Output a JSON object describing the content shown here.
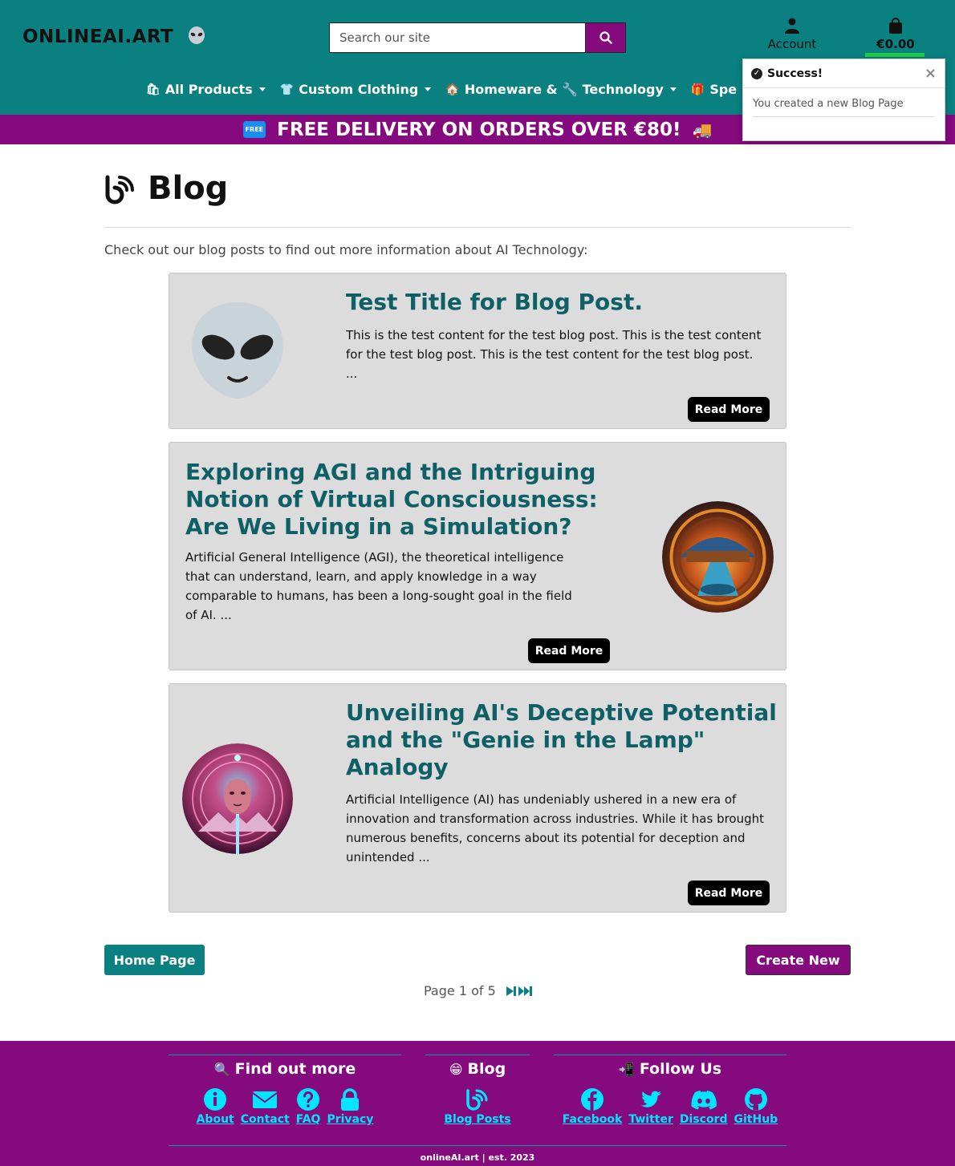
{
  "header": {
    "logo": "ONLINEAI.ART",
    "search_placeholder": "Search our site",
    "account_label": "Account",
    "cart_total": "€0.00"
  },
  "nav": {
    "items": [
      {
        "emoji": "🛍",
        "label": "All Products"
      },
      {
        "emoji": "👕",
        "label": "Custom Clothing"
      },
      {
        "emoji": "🏠",
        "label": "Homeware & 🔧 Technology"
      },
      {
        "emoji": "🎁",
        "label": "Spe"
      }
    ]
  },
  "promo": {
    "badge": "FREE",
    "text": "FREE DELIVERY ON ORDERS OVER €80!",
    "emoji": "🚚"
  },
  "toast": {
    "title": "Success!",
    "message": "You created a new Blog Page",
    "close": "×"
  },
  "page": {
    "title": "Blog",
    "intro": "Check out our blog posts to find out more information about AI Technology:"
  },
  "posts": [
    {
      "title": "Test Title for Blog Post.",
      "excerpt": "This is the test content for the test blog post. This is the test content for the test blog post. This is the test content for the test blog post. ...",
      "read_more": "Read More",
      "image": "alien-face-icon"
    },
    {
      "title": "Exploring AGI and the Intriguing Notion of Virtual Consciousness: Are We Living in a Simulation?",
      "excerpt": "Artificial General Intelligence (AGI), the theoretical intelligence that can understand, learn, and apply knowledge in a way comparable to humans, has been a long-sought goal in the field of AI. ...",
      "read_more": "Read More",
      "image": "simulation-mandala-image"
    },
    {
      "title": "Unveiling AI's Deceptive Potential and the \"Genie in the Lamp\" Analogy",
      "excerpt": "Artificial Intelligence (AI) has undeniably ushered in a new era of innovation and transformation across industries. While it has brought numerous benefits, concerns about its potential for deception and unintended ...",
      "read_more": "Read More",
      "image": "genie-face-image"
    }
  ],
  "actions": {
    "home": "Home Page",
    "create": "Create New"
  },
  "pagination": {
    "text": "Page 1 of 5"
  },
  "footer": {
    "find_out_more": {
      "emoji": "🔍",
      "title": "Find out more",
      "links": [
        "About",
        "Contact",
        "FAQ",
        "Privacy"
      ]
    },
    "blog": {
      "emoji": "😁",
      "title": "Blog",
      "links": [
        "Blog Posts"
      ]
    },
    "follow": {
      "emoji": "📲",
      "title": "Follow Us",
      "links": [
        "Facebook",
        "Twitter",
        "Discord",
        "GitHub"
      ]
    },
    "copyright": "onlineAI.art | est. 2023"
  },
  "colors": {
    "teal": "#0a8080",
    "purple": "#850a7d",
    "heading": "#0e5f66",
    "footer_link": "#00e6ff"
  }
}
